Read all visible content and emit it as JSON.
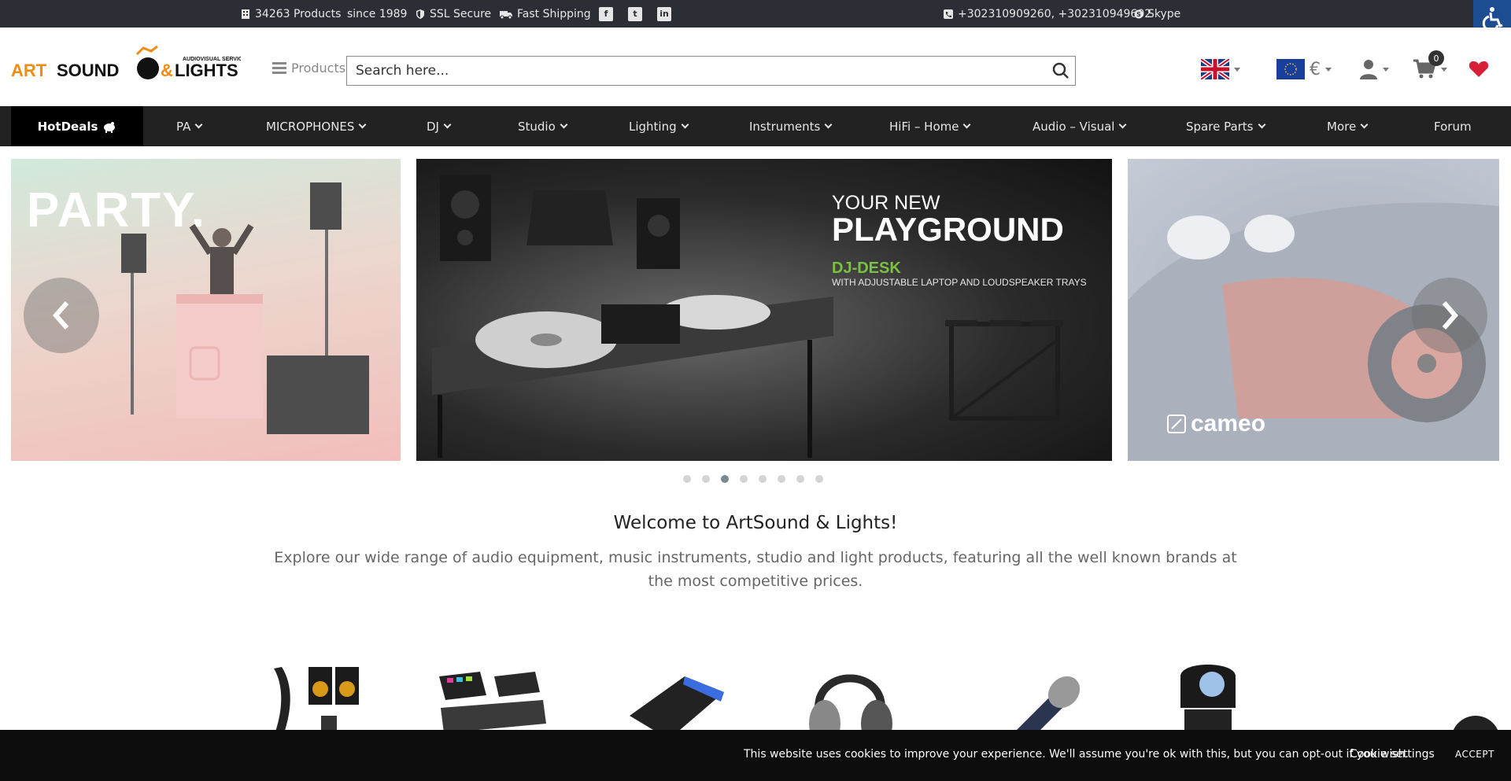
{
  "topbar": {
    "products_count": "34263 Products",
    "since": "since 1989",
    "ssl": "SSL Secure",
    "shipping": "Fast Shipping",
    "phones": "+302310909260, +302310949602",
    "skype": "Skype",
    "social_icons": [
      "facebook-icon",
      "twitter-icon",
      "linkedin-icon"
    ]
  },
  "header": {
    "logo_text": "ARTSOUND & LIGHTS",
    "logo_tagline": "AUDIOVISUAL SERVICES",
    "products_label": "Products",
    "search_placeholder": "Search here...",
    "currency": "€",
    "cart_count": "0"
  },
  "nav": {
    "hotdeals": "HotDeals",
    "items": [
      "PA",
      "MICROPHONES",
      "DJ",
      "Studio",
      "Lighting",
      "Instruments",
      "HiFi – Home",
      "Audio – Visual",
      "Spare Parts",
      "More",
      "Forum"
    ]
  },
  "slider": {
    "left_text": "PARTY.",
    "center_sub": "YOUR NEW",
    "center_title": "PLAYGROUND",
    "center_product": "DJ-DESK",
    "center_note": "WITH ADJUSTABLE LAPTOP AND LOUDSPEAKER TRAYS",
    "right_brand": "cameo",
    "dots_count": 8,
    "active_dot": 2
  },
  "welcome": {
    "title": "Welcome to ArtSound & Lights!",
    "text": "Explore our wide range of audio equipment, music instruments, studio and light products, featuring all the well known brands at the most competitive prices."
  },
  "categories": [
    "speakers-thumb",
    "dj-controllers-thumb",
    "mixer-thumb",
    "headphones-thumb",
    "microphone-thumb",
    "moving-head-thumb"
  ],
  "cookie": {
    "message": "This website uses cookies to improve your experience. We'll assume you're ok with this, but you can opt-out if you wish.",
    "settings": "Cookie settings",
    "accept": "ACCEPT"
  },
  "colors": {
    "topbar_bg": "#2b2f35",
    "nav_bg": "#222222",
    "hotdeals_bg": "#000000",
    "accent_red": "#d6203a",
    "accent_orange": "#f28b12",
    "accessibility_blue": "#1c4d91"
  }
}
